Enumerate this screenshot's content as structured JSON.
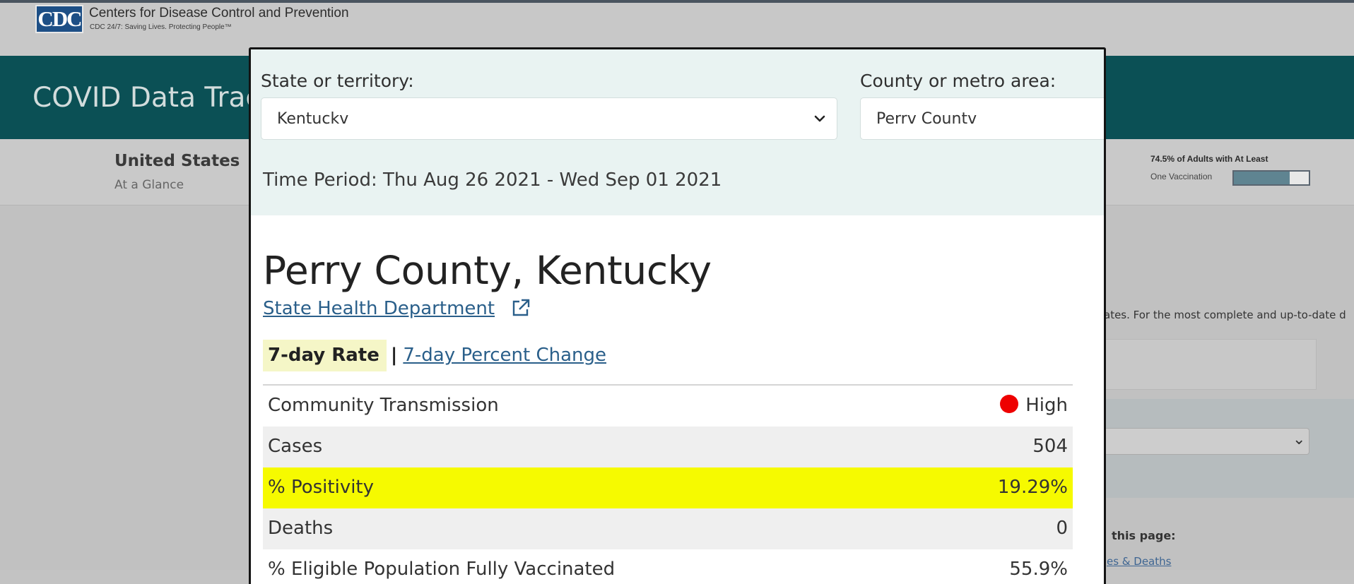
{
  "site": {
    "logo_text": "CDC",
    "name": "Centers for Disease Control and Prevention",
    "tagline": "CDC 24/7: Saving Lives. Protecting People™"
  },
  "banner": {
    "title": "COVID Data Trac"
  },
  "subnav": {
    "title": "United States",
    "subtitle": "At a Glance",
    "vaccination_label": "74.5% of Adults with At Least",
    "vaccination_sublabel": "One Vaccination",
    "vaccination_fraction": 0.745
  },
  "background": {
    "note_text": "ates. For the most complete and up-to-date d",
    "on_page_label": "this page:",
    "on_page_link": "es & Deaths"
  },
  "modal": {
    "state_label": "State or territory:",
    "state_value": "Kentuckv",
    "county_label": "County or metro area:",
    "county_value": "Perrv Countv",
    "time_period": "Time Period: Thu Aug 26 2021 - Wed Sep 01 2021",
    "county_title": "Perry County, Kentucky",
    "health_link": "State Health Department",
    "tab_active": "7-day Rate",
    "tab_separator": "|",
    "tab_other": "7-day Percent Change",
    "metrics": [
      {
        "label": "Community Transmission",
        "value": "High",
        "status_color": "#ee0000"
      },
      {
        "label": "Cases",
        "value": "504"
      },
      {
        "label": "% Positivity",
        "value": "19.29%"
      },
      {
        "label": "Deaths",
        "value": "0"
      },
      {
        "label": "% Eligible Population Fully Vaccinated",
        "value": "55.9%"
      }
    ]
  },
  "colors": {
    "banner": "#0b5055",
    "link": "#2a5f8a",
    "highlight": "#f6fa00",
    "active_tab": "#f5f6c7",
    "status_high": "#ee0000"
  }
}
